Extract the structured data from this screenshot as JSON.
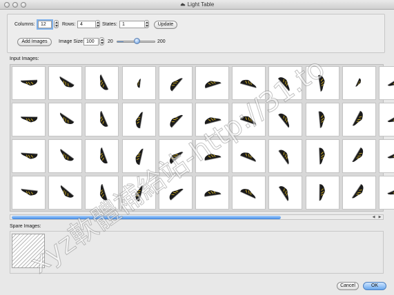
{
  "window": {
    "title": "Light Table"
  },
  "controls": {
    "columns_label": "Columns:",
    "columns_value": "12",
    "rows_label": "Rows:",
    "rows_value": "4",
    "states_label": "States:",
    "states_value": "1",
    "update_label": "Update",
    "add_images_label": "Add Images",
    "image_size_label": "Image Size:",
    "image_size_value": "100",
    "slider_min": "20",
    "slider_max": "200",
    "slider_fraction": 0.17
  },
  "input_images": {
    "label": "Input Images:",
    "columns": 12,
    "rows": 4
  },
  "spare_images": {
    "label": "Spare Images:"
  },
  "footer": {
    "cancel_label": "Cancel",
    "ok_label": "OK"
  },
  "watermark": "xyz軟體補給站-http://31.to",
  "icons": {
    "title_icon": "shoe-app-icon",
    "stepper": "stepper-arrows-icon"
  },
  "colors": {
    "accent": "#5d97de",
    "shoe": "#1b1b1b",
    "shoe_trim": "#d8b31d"
  }
}
